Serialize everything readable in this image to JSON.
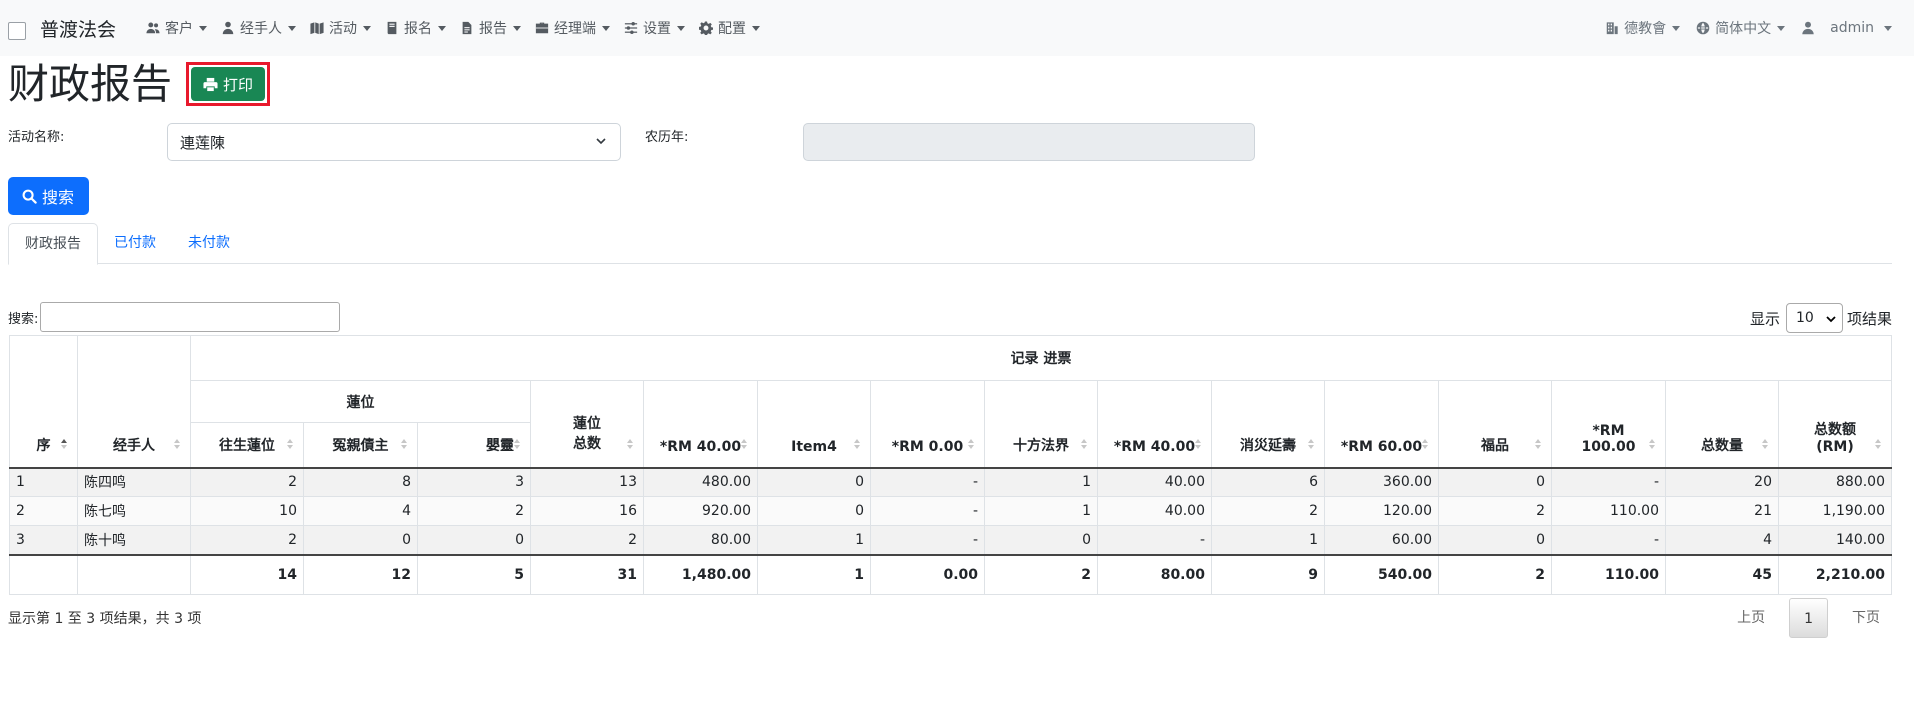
{
  "navbar": {
    "brand": "普渡法会",
    "menu": [
      {
        "label": "客户",
        "icon": "users-icon"
      },
      {
        "label": "经手人",
        "icon": "user-tie-icon"
      },
      {
        "label": "活动",
        "icon": "map-icon"
      },
      {
        "label": "报名",
        "icon": "book-icon"
      },
      {
        "label": "报告",
        "icon": "file-icon"
      },
      {
        "label": "经理端",
        "icon": "briefcase-icon"
      },
      {
        "label": "设置",
        "icon": "sliders-icon"
      },
      {
        "label": "配置",
        "icon": "gear-icon"
      }
    ],
    "right": {
      "org": "德教會",
      "language": "简体中文",
      "user": "admin"
    }
  },
  "header": {
    "title": "财政报告",
    "print_label": "打印"
  },
  "form": {
    "activity_label": "活动名称:",
    "activity_value": "連莲陳",
    "lunar_label": "农历年:",
    "lunar_value": "",
    "search_label": "搜索"
  },
  "tabs": [
    {
      "label": "财政报告",
      "active": true
    },
    {
      "label": "已付款",
      "active": false
    },
    {
      "label": "未付款",
      "active": false
    }
  ],
  "table_controls": {
    "search_label": "搜索:",
    "show_label": "显示",
    "page_length": "10",
    "results_label": "项结果"
  },
  "table": {
    "group_header": "记录 进票",
    "subgroup_header": "蓮位",
    "col_index": "序",
    "col_handler": "经手人",
    "columns": [
      "往生蓮位",
      "冤親債主",
      "嬰靈",
      "蓮位\n总数",
      "*RM 40.00",
      "Item4",
      "*RM 0.00",
      "十方法界",
      "*RM 40.00",
      "消災延壽",
      "*RM 60.00",
      "福品",
      "*RM\n100.00",
      "总数量",
      "总数额\n(RM)"
    ],
    "rows": [
      {
        "no": "1",
        "handler": "陈四鸣",
        "cells": [
          "2",
          "8",
          "3",
          "13",
          "480.00",
          "0",
          "-",
          "1",
          "40.00",
          "6",
          "360.00",
          "0",
          "-",
          "20",
          "880.00"
        ]
      },
      {
        "no": "2",
        "handler": "陈七鸣",
        "cells": [
          "10",
          "4",
          "2",
          "16",
          "920.00",
          "0",
          "-",
          "1",
          "40.00",
          "2",
          "120.00",
          "2",
          "110.00",
          "21",
          "1,190.00"
        ]
      },
      {
        "no": "3",
        "handler": "陈十鸣",
        "cells": [
          "2",
          "0",
          "0",
          "2",
          "80.00",
          "1",
          "-",
          "0",
          "-",
          "1",
          "60.00",
          "0",
          "-",
          "4",
          "140.00"
        ]
      }
    ],
    "totals": [
      "14",
      "12",
      "5",
      "31",
      "1,480.00",
      "1",
      "0.00",
      "2",
      "80.00",
      "9",
      "540.00",
      "2",
      "110.00",
      "45",
      "2,210.00"
    ]
  },
  "footer": {
    "info": "显示第 1 至 3 项结果，共 3 项",
    "prev": "上页",
    "current_page": "1",
    "next": "下页"
  },
  "colors": {
    "primary": "#0d6efd",
    "success": "#198754",
    "highlight_border": "#e8192c"
  }
}
